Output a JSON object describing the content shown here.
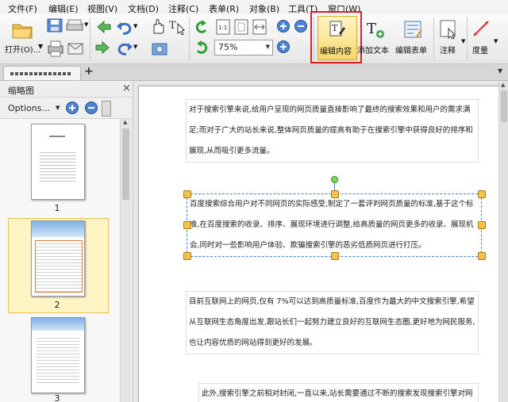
{
  "menu": {
    "file": "文件(F)",
    "edit": "编辑(E)",
    "view": "视图(V)",
    "document": "文档(D)",
    "comment": "注释(C)",
    "form": "表单(R)",
    "object": "对象(B)",
    "tools": "工具(T)",
    "window": "窗口(W)"
  },
  "toolbar": {
    "open_label": "打开(O)...",
    "zoom_value": "75%",
    "edit_content_label": "编辑内容",
    "add_text_label": "添加文本",
    "edit_form_label": "编辑表单",
    "annotate_label": "注释",
    "measure_label": "度量",
    "highlight_color": "#e02020"
  },
  "tabs": {
    "document_tab_label": "",
    "new_tab_symbol": "+"
  },
  "thumbnail_panel": {
    "title": "缩略图",
    "options_label": "Options...",
    "close_symbol": "×",
    "pages": [
      "1",
      "2",
      "3"
    ],
    "selected_page": "2"
  },
  "document": {
    "para1": "对于搜索引擎来说,给用户呈现的网页质量直接影响了最终的搜索效果和用户的需求满足;而对于广大的站长来说,整体网页质量的提高有助于在搜索引擎中获得良好的排序和展现,从而吸引更多流量。",
    "para2": "百度搜索综合用户对不同网页的实际感受,制定了一套评判网页质量的标准,基于这个标准,在百度搜索的收录、排序、展现环境进行调整,给高质量的网页更多的收录、展现机会,同时对一些影响用户体验、欺骗搜索引擎的恶劣低质网页进行打压。",
    "para3": "目前互联网上的网页,仅有 7%可以达到高质量标准,百度作为最大的中文搜索引擎,希望从互联网生态角度出发,跟站长们一起努力建立良好的互联网生态圈,更好地为网民服务,也让内容优质的网站得到更好的发展。",
    "para4": "此外,搜索引擎之前相对封闭,一直以来,站长需要通过不断的搜索发现搜索引擎对网"
  }
}
